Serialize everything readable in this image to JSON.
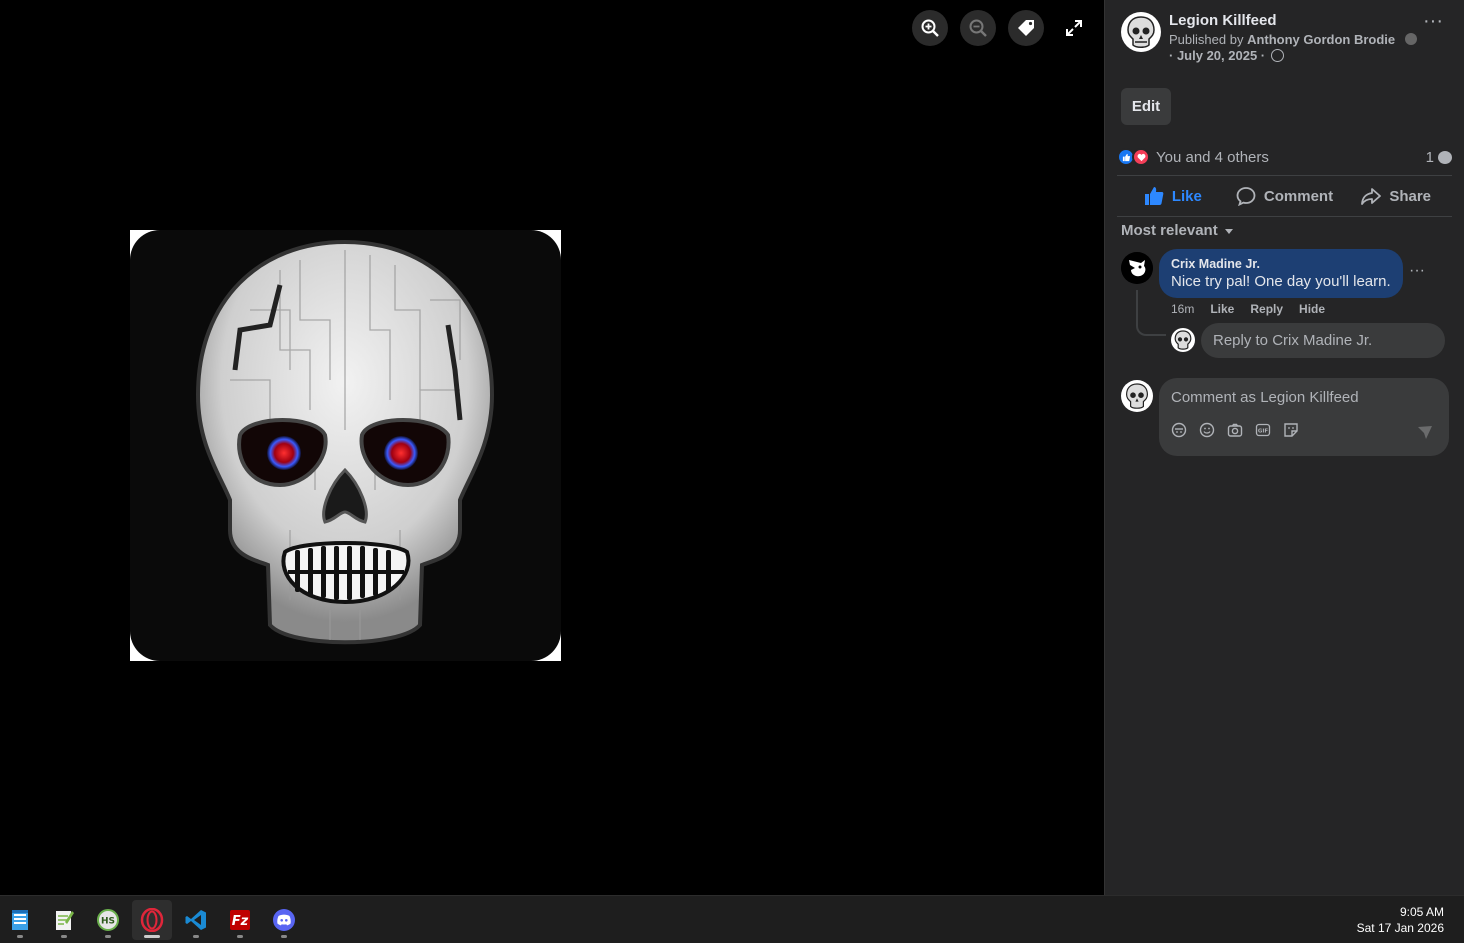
{
  "viewer": {
    "toolbar": [
      "zoom-in",
      "zoom-out",
      "tag",
      "fullscreen"
    ]
  },
  "post": {
    "page_name": "Legion Killfeed",
    "published_by_prefix": "Published by",
    "author": "Anthony Gordon Brodie",
    "date": "· July 20, 2025 ·",
    "edit_label": "Edit",
    "reactions_text": "You and 4 others",
    "comment_count": "1",
    "actions": {
      "like": "Like",
      "comment": "Comment",
      "share": "Share"
    },
    "sort_label": "Most relevant"
  },
  "comment": {
    "author": "Crix Madine Jr.",
    "text": "Nice try pal! One day you'll learn.",
    "time": "16m",
    "like": "Like",
    "reply": "Reply",
    "hide": "Hide"
  },
  "reply": {
    "placeholder": "Reply to Crix Madine Jr."
  },
  "composer": {
    "placeholder": "Comment as Legion Killfeed"
  },
  "taskbar": {
    "apps": [
      "notepad",
      "notepad-plus",
      "hs-app",
      "opera",
      "vscode",
      "filezilla",
      "discord"
    ],
    "active_app": "opera",
    "time": "9:05 AM",
    "date": "Sat 17 Jan 2026"
  },
  "colors": {
    "accent": "#2d88ff",
    "comment_bubble": "#1d3f73",
    "panel": "#252526"
  }
}
